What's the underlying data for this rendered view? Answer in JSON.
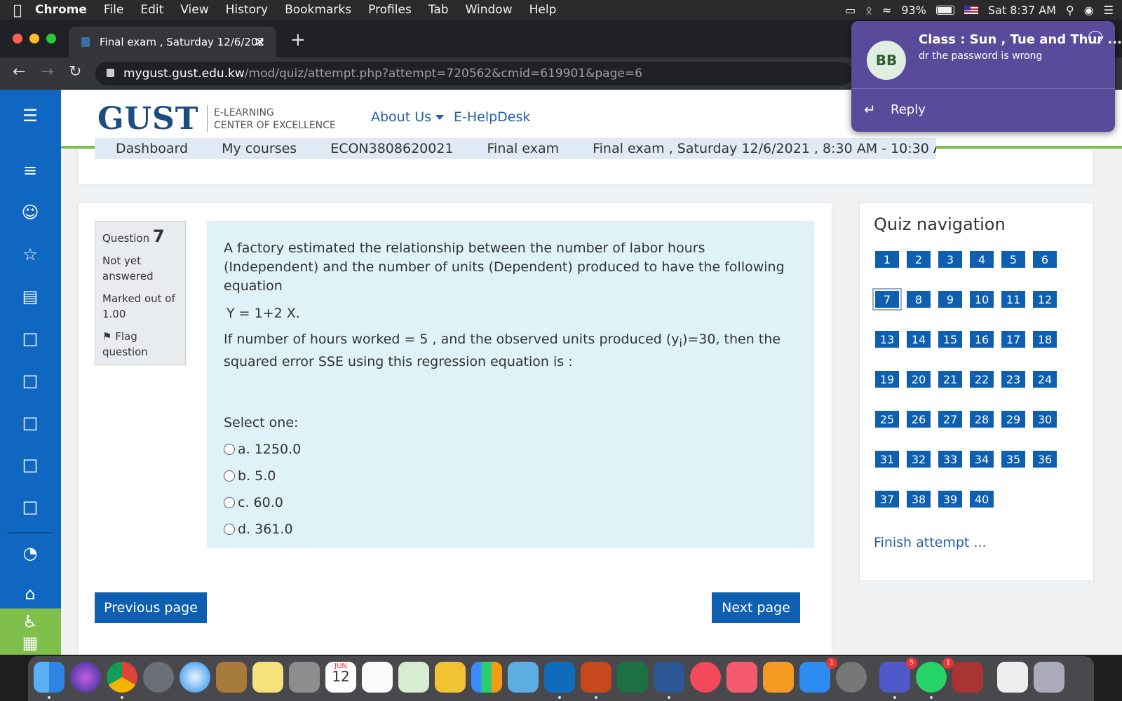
{
  "menubar": {
    "items": [
      "Chrome",
      "File",
      "Edit",
      "View",
      "History",
      "Bookmarks",
      "Profiles",
      "Tab",
      "Window",
      "Help"
    ],
    "battery": "93%",
    "clock": "Sat 8:37 AM"
  },
  "browser": {
    "tab_title": "Final exam , Saturday 12/6/202",
    "url_host": "mygust.gust.edu.kw",
    "url_path": "/mod/quiz/attempt.php?attempt=720562&cmid=619901&page=6"
  },
  "notification": {
    "avatar": "BB",
    "title": "Class : Sun , Tue and Thur ...",
    "body": "dr the password is wrong",
    "reply": "Reply"
  },
  "header": {
    "logo": "GUST",
    "logo_line1": "E-LEARNING",
    "logo_line2": "CENTER OF EXCELLENCE",
    "about": "About Us",
    "helpdesk": "E-HelpDesk"
  },
  "breadcrumb": [
    "Dashboard",
    "My courses",
    "ECON3808620021",
    "Final exam",
    "Final exam , Saturday 12/6/2021 , 8:30 AM - 10:30 AM"
  ],
  "question": {
    "label": "Question",
    "number": "7",
    "status": "Not yet answered",
    "marked": "Marked out of 1.00",
    "flag": "Flag question",
    "text1": "A factory estimated the relationship between the number of labor hours (Independent)  and the number of units (Dependent) produced to have the following equation",
    "equation": "Y = 1+2 X.",
    "text2_a": "If number of hours worked = 5 , and the observed units produced (y",
    "text2_sub": "i",
    "text2_b": ")=30, then the squared error SSE using this regression equation  is :",
    "select_one": "Select one:",
    "options": [
      "a. 1250.0",
      "b. 5.0",
      "c. 60.0",
      "d. 361.0"
    ]
  },
  "buttons": {
    "previous": "Previous page",
    "next": "Next page"
  },
  "quiz_nav": {
    "title": "Quiz navigation",
    "numbers": [
      "1",
      "2",
      "3",
      "4",
      "5",
      "6",
      "7",
      "8",
      "9",
      "10",
      "11",
      "12",
      "13",
      "14",
      "15",
      "16",
      "17",
      "18",
      "19",
      "20",
      "21",
      "22",
      "23",
      "24",
      "25",
      "26",
      "27",
      "28",
      "29",
      "30",
      "31",
      "32",
      "33",
      "34",
      "35",
      "36",
      "37",
      "38",
      "39",
      "40"
    ],
    "current": "7",
    "finish": "Finish attempt ..."
  },
  "dock": {
    "badges": [
      "1",
      "5",
      "1"
    ],
    "calendar_month": "JUN",
    "calendar_day": "12"
  }
}
